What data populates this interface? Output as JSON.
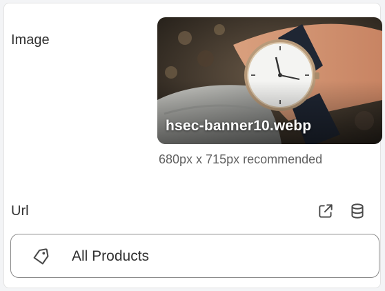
{
  "image_section": {
    "label": "Image",
    "filename": "hsec-banner10.webp",
    "hint": "680px x 715px recommended"
  },
  "url_section": {
    "label": "Url",
    "open_icon": "external-link-icon",
    "source_icon": "database-icon",
    "selected": {
      "icon": "tag-icon",
      "text": "All Products"
    }
  },
  "colors": {
    "text": "#303030",
    "muted": "#616161",
    "border": "#8a8a8a"
  }
}
